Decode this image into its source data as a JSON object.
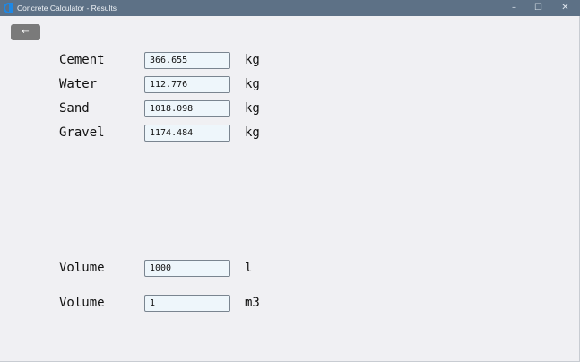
{
  "window": {
    "title": "Concrete Calculator - Results",
    "minimize_glyph": "–",
    "maximize_glyph": "☐",
    "close_glyph": "✕",
    "icon": "app-icon"
  },
  "toolbar": {
    "back_glyph": "←"
  },
  "materials": [
    {
      "label": "Cement",
      "value": "366.655",
      "unit": "kg"
    },
    {
      "label": "Water",
      "value": "112.776",
      "unit": "kg"
    },
    {
      "label": "Sand",
      "value": "1018.098",
      "unit": "kg"
    },
    {
      "label": "Gravel",
      "value": "1174.484",
      "unit": "kg"
    }
  ],
  "volumes": [
    {
      "label": "Volume",
      "value": "1000",
      "unit": "l"
    },
    {
      "label": "Volume",
      "value": "1",
      "unit": "m3"
    }
  ],
  "colors": {
    "titlebar": "#5d7186",
    "background": "#f0f0f3",
    "field_background": "#eef6fb",
    "back_button": "#7a7a7a"
  }
}
